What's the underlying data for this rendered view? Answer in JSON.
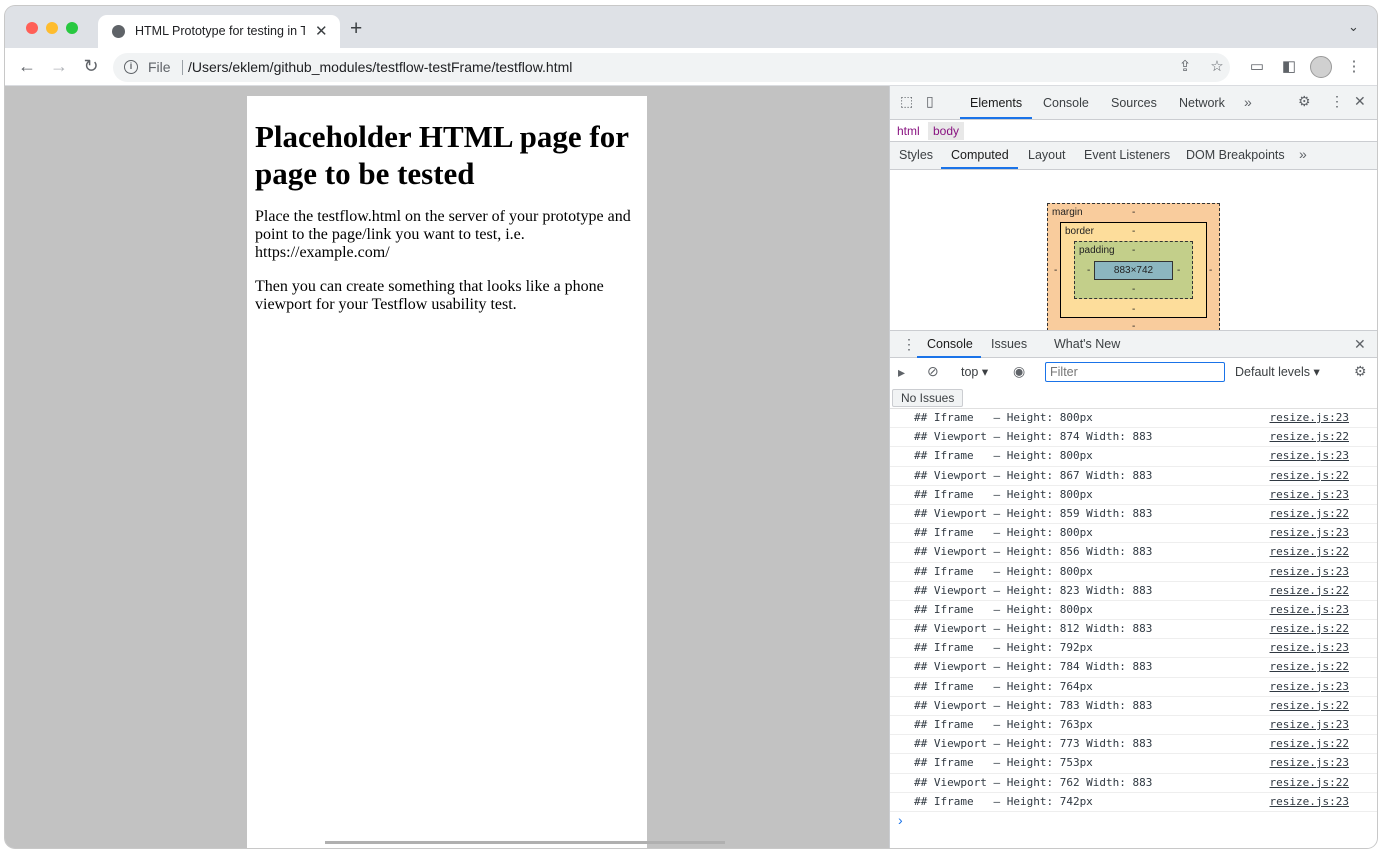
{
  "tab": {
    "title": "HTML Prototype for testing in Testflow",
    "close": "✕",
    "new_tab": "+"
  },
  "toolbar": {
    "back": "←",
    "forward": "→",
    "reload": "↻",
    "scheme": "File",
    "url": "/Users/eklem/github_modules/testflow-testFrame/testflow.html"
  },
  "page": {
    "heading": "Placeholder HTML page for page to be tested",
    "paragraph1": "Place the testflow.html on the server of your prototype and point to the page/link you want to test, i.e. https://example.com/",
    "paragraph2": "Then you can create something that looks like a phone viewport for your Testflow usability test."
  },
  "devtools": {
    "main_tabs": [
      "Elements",
      "Console",
      "Sources",
      "Network"
    ],
    "breadcrumbs": [
      "html",
      "body"
    ],
    "sub_tabs": [
      "Styles",
      "Computed",
      "Layout",
      "Event Listeners",
      "DOM Breakpoints"
    ],
    "box_model": {
      "margin": "margin",
      "border": "border",
      "padding": "padding",
      "content": "883×742",
      "dash": "-"
    },
    "drawer_tabs": [
      "Console",
      "Issues",
      "What's New"
    ],
    "context": "top ▾",
    "filter_placeholder": "Filter",
    "levels": "Default levels ▾",
    "no_issues": "No Issues",
    "logs": [
      {
        "msg": "## Iframe   – Height: 800px",
        "src": "resize.js:23"
      },
      {
        "msg": "## Viewport – Height: 874 Width: 883",
        "src": "resize.js:22"
      },
      {
        "msg": "## Iframe   – Height: 800px",
        "src": "resize.js:23"
      },
      {
        "msg": "## Viewport – Height: 867 Width: 883",
        "src": "resize.js:22"
      },
      {
        "msg": "## Iframe   – Height: 800px",
        "src": "resize.js:23"
      },
      {
        "msg": "## Viewport – Height: 859 Width: 883",
        "src": "resize.js:22"
      },
      {
        "msg": "## Iframe   – Height: 800px",
        "src": "resize.js:23"
      },
      {
        "msg": "## Viewport – Height: 856 Width: 883",
        "src": "resize.js:22"
      },
      {
        "msg": "## Iframe   – Height: 800px",
        "src": "resize.js:23"
      },
      {
        "msg": "## Viewport – Height: 823 Width: 883",
        "src": "resize.js:22"
      },
      {
        "msg": "## Iframe   – Height: 800px",
        "src": "resize.js:23"
      },
      {
        "msg": "## Viewport – Height: 812 Width: 883",
        "src": "resize.js:22"
      },
      {
        "msg": "## Iframe   – Height: 792px",
        "src": "resize.js:23"
      },
      {
        "msg": "## Viewport – Height: 784 Width: 883",
        "src": "resize.js:22"
      },
      {
        "msg": "## Iframe   – Height: 764px",
        "src": "resize.js:23"
      },
      {
        "msg": "## Viewport – Height: 783 Width: 883",
        "src": "resize.js:22"
      },
      {
        "msg": "## Iframe   – Height: 763px",
        "src": "resize.js:23"
      },
      {
        "msg": "## Viewport – Height: 773 Width: 883",
        "src": "resize.js:22"
      },
      {
        "msg": "## Iframe   – Height: 753px",
        "src": "resize.js:23"
      },
      {
        "msg": "## Viewport – Height: 762 Width: 883",
        "src": "resize.js:22"
      },
      {
        "msg": "## Iframe   – Height: 742px",
        "src": "resize.js:23"
      }
    ],
    "prompt": "›",
    "colors": {
      "accent": "#1a73e8",
      "margin": "#f9cc9d",
      "border": "#fddd9b",
      "padding": "#c3cf8a",
      "content": "#8cb6c0"
    }
  }
}
